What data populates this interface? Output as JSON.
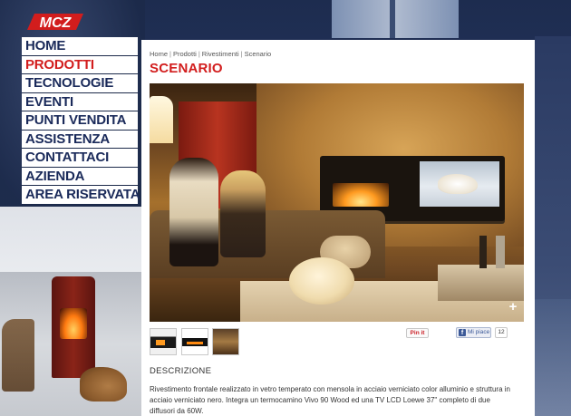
{
  "brand": {
    "logo_text": "MCZ",
    "accent": "#d21d1d",
    "nav_text_color": "#1a2a5a"
  },
  "nav": {
    "items": [
      {
        "label": "HOME",
        "active": false
      },
      {
        "label": "PRODOTTI",
        "active": true
      },
      {
        "label": "TECNOLOGIE",
        "active": false
      },
      {
        "label": "EVENTI",
        "active": false
      },
      {
        "label": "PUNTI VENDITA",
        "active": false
      },
      {
        "label": "ASSISTENZA",
        "active": false
      },
      {
        "label": "CONTATTACI",
        "active": false
      },
      {
        "label": "AZIENDA",
        "active": false
      },
      {
        "label": "AREA RISERVATA",
        "active": false
      }
    ]
  },
  "breadcrumb": [
    "Home",
    "Prodotti",
    "Rivestimenti",
    "Scenario"
  ],
  "page": {
    "title": "SCENARIO"
  },
  "social": {
    "pinit_label": "Pin it",
    "fb_label": "Mi piace",
    "fb_count": "12"
  },
  "description": {
    "heading": "DESCRIZIONE",
    "text": "Rivestimento frontale realizzato in vetro temperato con mensola in acciaio verniciato color alluminio e struttura in acciaio verniciato nero. Integra un termocamino Vivo 90 Wood ed una TV LCD Loewe 37\" completo di due diffusori da 60W."
  }
}
